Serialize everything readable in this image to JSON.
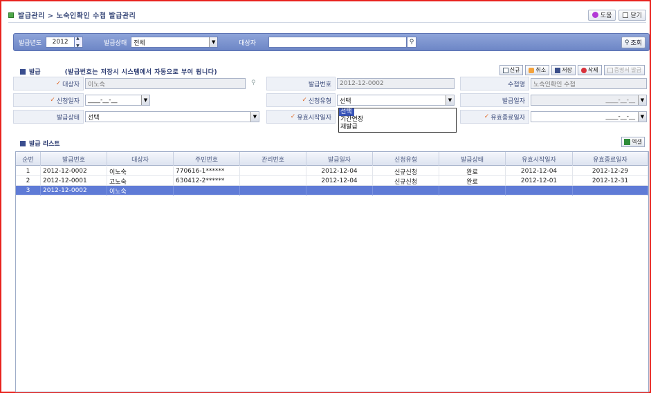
{
  "breadcrumb": "발급관리 > 노숙인확인 수첩 발급관리",
  "buttons": {
    "help": "도움",
    "close": "닫기"
  },
  "search": {
    "year_label": "발급년도",
    "year_value": "2012",
    "status_label": "발급상태",
    "status_value": "전체",
    "target_label": "대상자",
    "target_value": "",
    "search_button": "조회"
  },
  "issue": {
    "section_title": "발급",
    "note": "(발급번호는 저장시 시스템에서 자동으로 부여 됩니다)",
    "actions": {
      "new": "신규",
      "cancel": "취소",
      "save": "저장",
      "delete": "삭제",
      "print": "증명서 발급"
    },
    "fields": {
      "target_label": "대상자",
      "target_value": "이노숙",
      "issue_no_label": "발급번호",
      "issue_no_value": "2012-12-0002",
      "notebook_label": "수첩명",
      "notebook_value": "노숙인확인 수첩",
      "apply_date_label": "신청일자",
      "apply_date_value": "____-__-__",
      "apply_type_label": "신청유형",
      "apply_type_value": "선택",
      "issue_date_label": "발급일자",
      "issue_date_value": "____-__-__",
      "issue_status_label": "발급상태",
      "issue_status_value": "선택",
      "valid_start_label": "유효시작일자",
      "valid_end_label": "유효종료일자",
      "valid_end_value": "____-__-__"
    },
    "apply_type_options": [
      "선택",
      "기간연장",
      "재발급"
    ]
  },
  "list": {
    "section_title": "발급 리스트",
    "excel_button": "엑셀",
    "columns": [
      "순번",
      "발급번호",
      "대상자",
      "주민번호",
      "관리번호",
      "발급일자",
      "신청유형",
      "발급상태",
      "유효시작일자",
      "유효종료일자"
    ],
    "rows": [
      {
        "no": "1",
        "issue_no": "2012-12-0002",
        "name": "이노숙",
        "rrn": "770616-1******",
        "mgmt": "",
        "issue_date": "2012-12-04",
        "type": "신규신청",
        "status": "완료",
        "start": "2012-12-04",
        "end": "2012-12-29"
      },
      {
        "no": "2",
        "issue_no": "2012-12-0001",
        "name": "고노숙",
        "rrn": "630412-2******",
        "mgmt": "",
        "issue_date": "2012-12-04",
        "type": "신규신청",
        "status": "완료",
        "start": "2012-12-01",
        "end": "2012-12-31"
      },
      {
        "no": "3",
        "issue_no": "2012-12-0002",
        "name": "이노숙",
        "rrn": "",
        "mgmt": "",
        "issue_date": "",
        "type": "",
        "status": "",
        "start": "",
        "end": ""
      }
    ]
  },
  "colors": {
    "accent": "#6d86c6",
    "selected_row": "#5f7bd6",
    "border_frame": "#e8231e"
  }
}
